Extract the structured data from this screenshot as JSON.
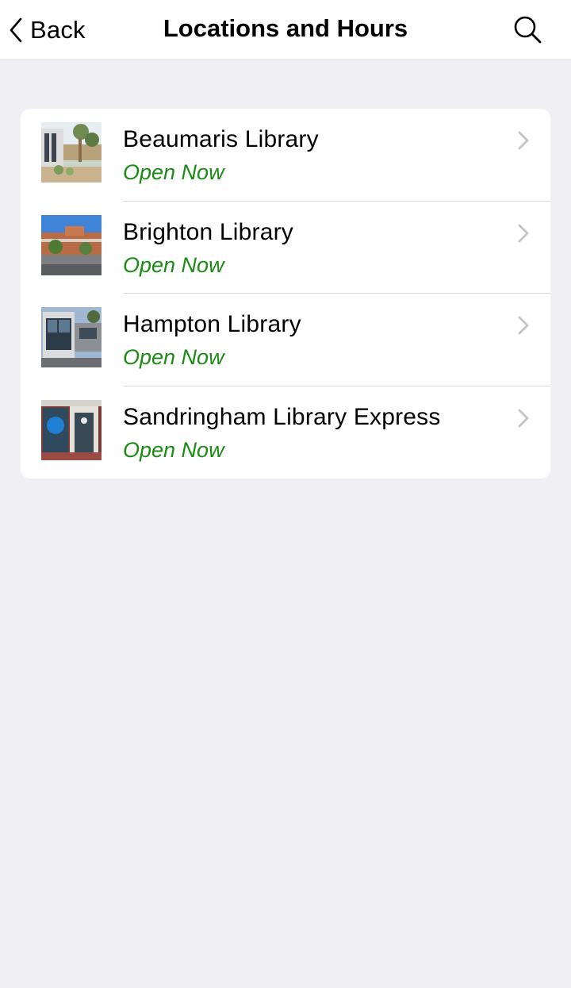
{
  "navbar": {
    "back_label": "Back",
    "title": "Locations and Hours",
    "back_icon": "chevron-left-icon",
    "search_icon": "search-icon"
  },
  "locations": [
    {
      "name": "Beaumaris Library",
      "status": "Open Now"
    },
    {
      "name": "Brighton Library",
      "status": "Open Now"
    },
    {
      "name": "Hampton Library",
      "status": "Open Now"
    },
    {
      "name": "Sandringham Library Express",
      "status": "Open Now"
    }
  ],
  "colors": {
    "status_open": "#1a8c13",
    "background": "#efeff4",
    "chevron": "#c4c4c7"
  }
}
